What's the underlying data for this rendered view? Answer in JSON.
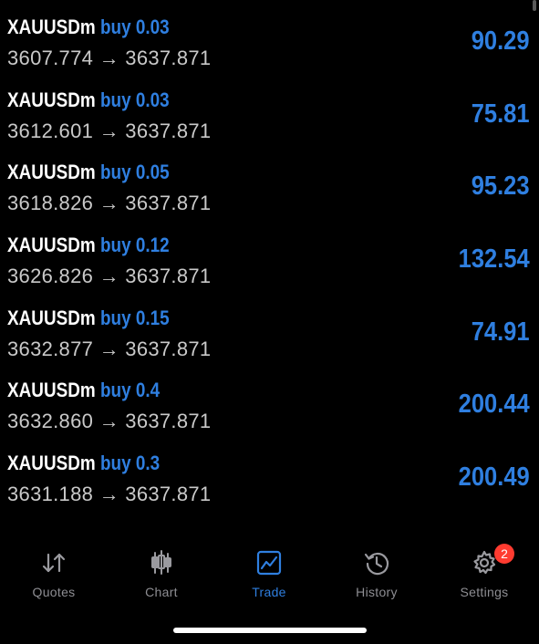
{
  "trades": [
    {
      "symbol": "XAUUSDm",
      "action": "buy 0.03",
      "prices": "3607.774 → 3637.871",
      "profit": "90.29"
    },
    {
      "symbol": "XAUUSDm",
      "action": "buy 0.03",
      "prices": "3612.601 → 3637.871",
      "profit": "75.81"
    },
    {
      "symbol": "XAUUSDm",
      "action": "buy 0.05",
      "prices": "3618.826 → 3637.871",
      "profit": "95.23"
    },
    {
      "symbol": "XAUUSDm",
      "action": "buy 0.12",
      "prices": "3626.826 → 3637.871",
      "profit": "132.54"
    },
    {
      "symbol": "XAUUSDm",
      "action": "buy 0.15",
      "prices": "3632.877 → 3637.871",
      "profit": "74.91"
    },
    {
      "symbol": "XAUUSDm",
      "action": "buy 0.4",
      "prices": "3632.860 → 3637.871",
      "profit": "200.44"
    },
    {
      "symbol": "XAUUSDm",
      "action": "buy 0.3",
      "prices": "3631.188 → 3637.871",
      "profit": "200.49"
    }
  ],
  "tabs": [
    {
      "label": "Quotes",
      "icon": "sort-arrows-icon",
      "active": false
    },
    {
      "label": "Chart",
      "icon": "candlestick-icon",
      "active": false
    },
    {
      "label": "Trade",
      "icon": "line-chart-icon",
      "active": true
    },
    {
      "label": "History",
      "icon": "history-clock-icon",
      "active": false
    },
    {
      "label": "Settings",
      "icon": "gear-icon",
      "active": false
    }
  ],
  "settings_badge": "2",
  "colors": {
    "background": "#000000",
    "accent": "#2f7fe0",
    "inactive": "#8e8e93",
    "badge": "#ff3b30",
    "secondary_text": "#c9c9c9"
  }
}
